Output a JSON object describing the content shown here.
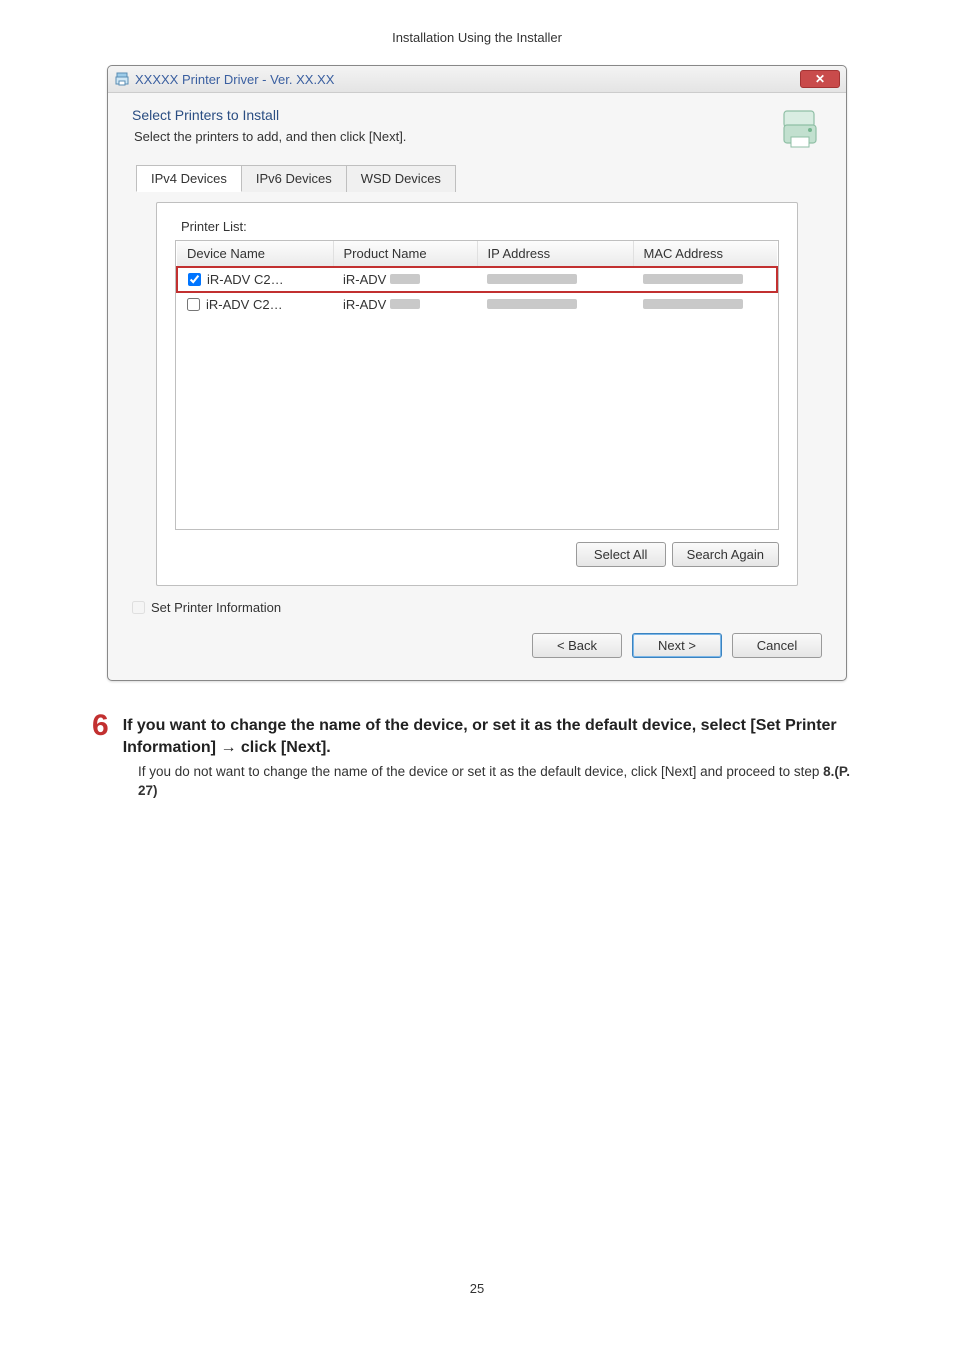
{
  "doc": {
    "header": "Installation Using the Installer",
    "page_number": "25"
  },
  "window": {
    "title": "XXXXX Printer Driver - Ver. XX.XX",
    "header_title": "Select Printers to Install",
    "header_sub": "Select the printers to add, and then click [Next].",
    "tabs": {
      "ipv4": "IPv4 Devices",
      "ipv6": "IPv6 Devices",
      "wsd": "WSD Devices"
    },
    "printer_list_label": "Printer List:",
    "columns": {
      "device": "Device Name",
      "product": "Product Name",
      "ip": "IP Address",
      "mac": "MAC Address"
    },
    "rows": [
      {
        "checked": true,
        "device": "iR-ADV C2…",
        "product": "iR-ADV"
      },
      {
        "checked": false,
        "device": "iR-ADV C2…",
        "product": "iR-ADV"
      }
    ],
    "buttons": {
      "select_all": "Select All",
      "search_again": "Search Again",
      "back": "< Back",
      "next": "Next >",
      "cancel": "Cancel"
    },
    "set_printer_info": "Set Printer Information"
  },
  "step": {
    "num": "6",
    "text": "If you want to change the name of the device, or set it as the default device, select [Set Printer Information] → click [Next].",
    "note_pre": "If you do not want to change the name of the device or set it as the default device, click [Next] and proceed to step ",
    "note_ref": "8.(P. 27)"
  }
}
